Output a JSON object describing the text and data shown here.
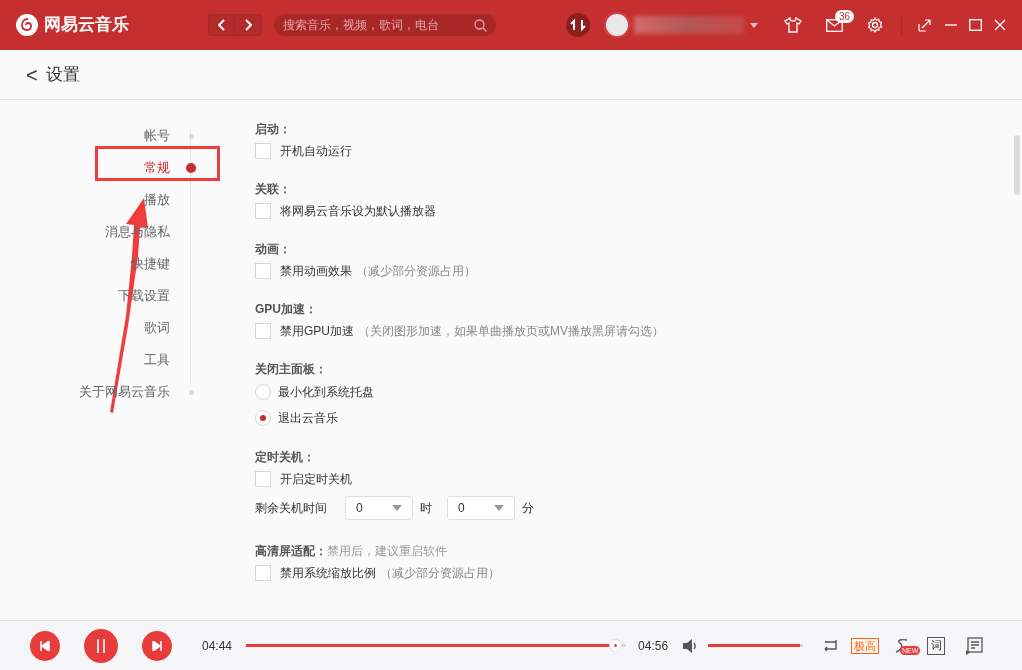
{
  "app": {
    "name": "网易云音乐"
  },
  "search": {
    "placeholder": "搜索音乐，视频，歌词，电台"
  },
  "mail_badge": "36",
  "page": {
    "back": "<",
    "title": "设置"
  },
  "sidebar": {
    "items": [
      {
        "label": "帐号",
        "selected": false
      },
      {
        "label": "常规",
        "selected": true
      },
      {
        "label": "播放",
        "selected": false
      },
      {
        "label": "消息与隐私",
        "selected": false
      },
      {
        "label": "快捷键",
        "selected": false
      },
      {
        "label": "下载设置",
        "selected": false
      },
      {
        "label": "歌词",
        "selected": false
      },
      {
        "label": "工具",
        "selected": false
      },
      {
        "label": "关于网易云音乐",
        "selected": false
      }
    ]
  },
  "sections": [
    {
      "title": "启动：",
      "items": [
        {
          "kind": "checkbox",
          "label": "开机自动运行",
          "checked": false
        }
      ]
    },
    {
      "title": "关联：",
      "items": [
        {
          "kind": "checkbox",
          "label": "将网易云音乐设为默认播放器",
          "checked": false
        }
      ]
    },
    {
      "title": "动画：",
      "items": [
        {
          "kind": "checkbox",
          "label": "禁用动画效果",
          "note": "（减少部分资源占用）",
          "checked": false
        }
      ]
    },
    {
      "title": "GPU加速：",
      "items": [
        {
          "kind": "checkbox",
          "label": "禁用GPU加速",
          "note": "（关闭图形加速，如果单曲播放页或MV播放黑屏请勾选）",
          "checked": false
        }
      ]
    },
    {
      "title": "关闭主面板：",
      "items": [
        {
          "kind": "radio",
          "label": "最小化到系统托盘",
          "selected": false
        },
        {
          "kind": "radio",
          "label": "退出云音乐",
          "selected": true
        }
      ]
    },
    {
      "title": "定时关机：",
      "items": [
        {
          "kind": "checkbox",
          "label": "开启定时关机",
          "checked": false
        },
        {
          "kind": "timer",
          "label": "剩余关机时间",
          "hours": "0",
          "hours_unit": "时",
          "minutes": "0",
          "minutes_unit": "分"
        }
      ]
    },
    {
      "title": "高清屏适配：",
      "hint": "禁用后，建议重启软件",
      "items": [
        {
          "kind": "checkbox",
          "label": "禁用系统缩放比例",
          "note": "（减少部分资源占用）",
          "checked": false
        }
      ]
    }
  ],
  "player": {
    "elapsed": "04:44",
    "total": "04:56",
    "progress": {
      "level": 0.97
    },
    "volume": {
      "level": 0.97
    },
    "quality": "极高",
    "new_badge": "NEW",
    "lyrics_button": "词"
  }
}
